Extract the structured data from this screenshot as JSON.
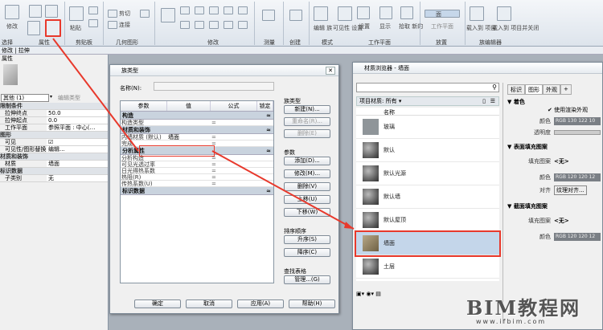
{
  "ribbon": {
    "groups": [
      "选择",
      "属性",
      "剪贴板",
      "几何图形",
      "修改",
      "测量",
      "创建",
      "模式",
      "工作平面",
      "放置",
      "族编辑器"
    ],
    "tools": {
      "modify": "修改",
      "paste": "粘贴",
      "cut": "剪切",
      "join": "连接",
      "editFamily": "编辑\n族",
      "displayWorkplane": "可见性\n设置",
      "set": "设置",
      "show": "显示",
      "pickNew": "拾取\n新的",
      "face": "面",
      "workplane": "工作平面",
      "loadProject": "载入到\n项目",
      "loadClose": "载入到\n项目并关闭"
    }
  },
  "ctxbar": "修改 | 拉伸",
  "props": {
    "title": "属性",
    "typeSelector": "其他 (1)",
    "editType": "编辑类型",
    "rows": [
      {
        "cat": true,
        "label": "限制条件"
      },
      {
        "label": "拉伸终点",
        "value": "50.0"
      },
      {
        "label": "拉伸起点",
        "value": "0.0"
      },
      {
        "label": "工作平面",
        "value": "参照平面 : 中心(…"
      },
      {
        "cat": true,
        "label": "图形"
      },
      {
        "label": "可见",
        "value": "☑"
      },
      {
        "label": "可见性/图形替换",
        "value": "编辑..."
      },
      {
        "cat": true,
        "label": "材质和装饰"
      },
      {
        "label": "材质",
        "value": "墙面"
      },
      {
        "cat": true,
        "label": "标识数据"
      },
      {
        "label": "子类别",
        "value": "无"
      }
    ]
  },
  "familyTypes": {
    "title": "族类型",
    "nameLabel": "名称(N):",
    "headers": [
      "参数",
      "值",
      "公式",
      "锁定"
    ],
    "sections": [
      {
        "name": "构造",
        "rows": [
          [
            "构造类型",
            "",
            "="
          ]
        ]
      },
      {
        "name": "材质和装饰",
        "rows": [
          [
            "内墙材质 (默认)",
            "墙面",
            "="
          ],
          [
            "完成",
            "",
            "="
          ]
        ]
      },
      {
        "name": "分析属性",
        "rows": [
          [
            "分析构造",
            "",
            "="
          ],
          [
            "可见光透过率",
            "",
            "="
          ],
          [
            "日光得热系数",
            "",
            "="
          ],
          [
            "热阻(R)",
            "",
            "="
          ],
          [
            "传热系数(U)",
            "",
            "="
          ]
        ]
      },
      {
        "name": "标识数据",
        "rows": []
      }
    ],
    "sideLabels": {
      "familyTypes": "族类型",
      "params": "参数",
      "sort": "排序顺序",
      "lookup": "查找表格"
    },
    "sideButtons": {
      "new": "新建(N)...",
      "rename": "重命名(R)...",
      "delete1": "删除(E)",
      "add": "添加(D)...",
      "modify": "修改(M)...",
      "delete2": "删除(V)",
      "up": "上移(U)",
      "down": "下移(W)",
      "asc": "升序(S)",
      "desc": "降序(C)",
      "manage": "管理...(G)"
    },
    "footer": {
      "ok": "确定",
      "cancel": "取消",
      "apply": "应用(A)",
      "help": "帮助(H)"
    }
  },
  "materialBrowser": {
    "title": "材质浏览器 - 墙面",
    "search": "",
    "filter": "项目材质: 所有",
    "column": "名称",
    "items": [
      "玻璃",
      "默认",
      "默认光源",
      "默认墙",
      "默认屋顶",
      "墙面",
      "土层"
    ],
    "selected": 5,
    "tabs": [
      "标识",
      "图形",
      "外观",
      "+"
    ],
    "shading": {
      "header": "着色",
      "useRender": "使用渲染外观",
      "colorLabel": "颜色",
      "color": "RGB 130 122 10",
      "transLabel": "透明度"
    },
    "surface": {
      "header": "表面填充图案",
      "patternLabel": "填充图案",
      "pattern": "<无>",
      "colorLabel": "颜色",
      "color": "RGB 120 120 12",
      "alignLabel": "对齐",
      "align": "纹理对齐..."
    },
    "cut": {
      "header": "截面填充图案",
      "patternLabel": "填充图案",
      "pattern": "<无>",
      "colorLabel": "颜色",
      "color": "RGB 120 120 12"
    }
  },
  "watermark": {
    "text": "BIM教程网",
    "url": "www.ifbim.com"
  }
}
